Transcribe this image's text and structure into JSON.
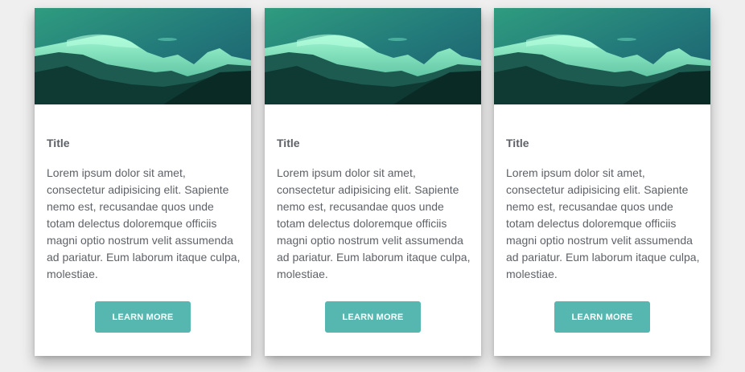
{
  "cards": [
    {
      "title": "Title",
      "body": "Lorem ipsum dolor sit amet, consectetur adipisicing elit. Sapiente nemo est, recusandae quos unde totam delectus doloremque officiis magni optio nostrum velit assumenda ad pariatur. Eum laborum itaque culpa, molestiae.",
      "button_label": "LEARN MORE"
    },
    {
      "title": "Title",
      "body": "Lorem ipsum dolor sit amet, consectetur adipisicing elit. Sapiente nemo est, recusandae quos unde totam delectus doloremque officiis magni optio nostrum velit assumenda ad pariatur. Eum laborum itaque culpa, molestiae.",
      "button_label": "LEARN MORE"
    },
    {
      "title": "Title",
      "body": "Lorem ipsum dolor sit amet, consectetur adipisicing elit. Sapiente nemo est, recusandae quos unde totam delectus doloremque officiis magni optio nostrum velit assumenda ad pariatur. Eum laborum itaque culpa, molestiae.",
      "button_label": "LEARN MORE"
    }
  ],
  "colors": {
    "accent": "#55b7b0",
    "text": "#5e6268",
    "page_background": "#efefef",
    "card_background": "#ffffff"
  }
}
